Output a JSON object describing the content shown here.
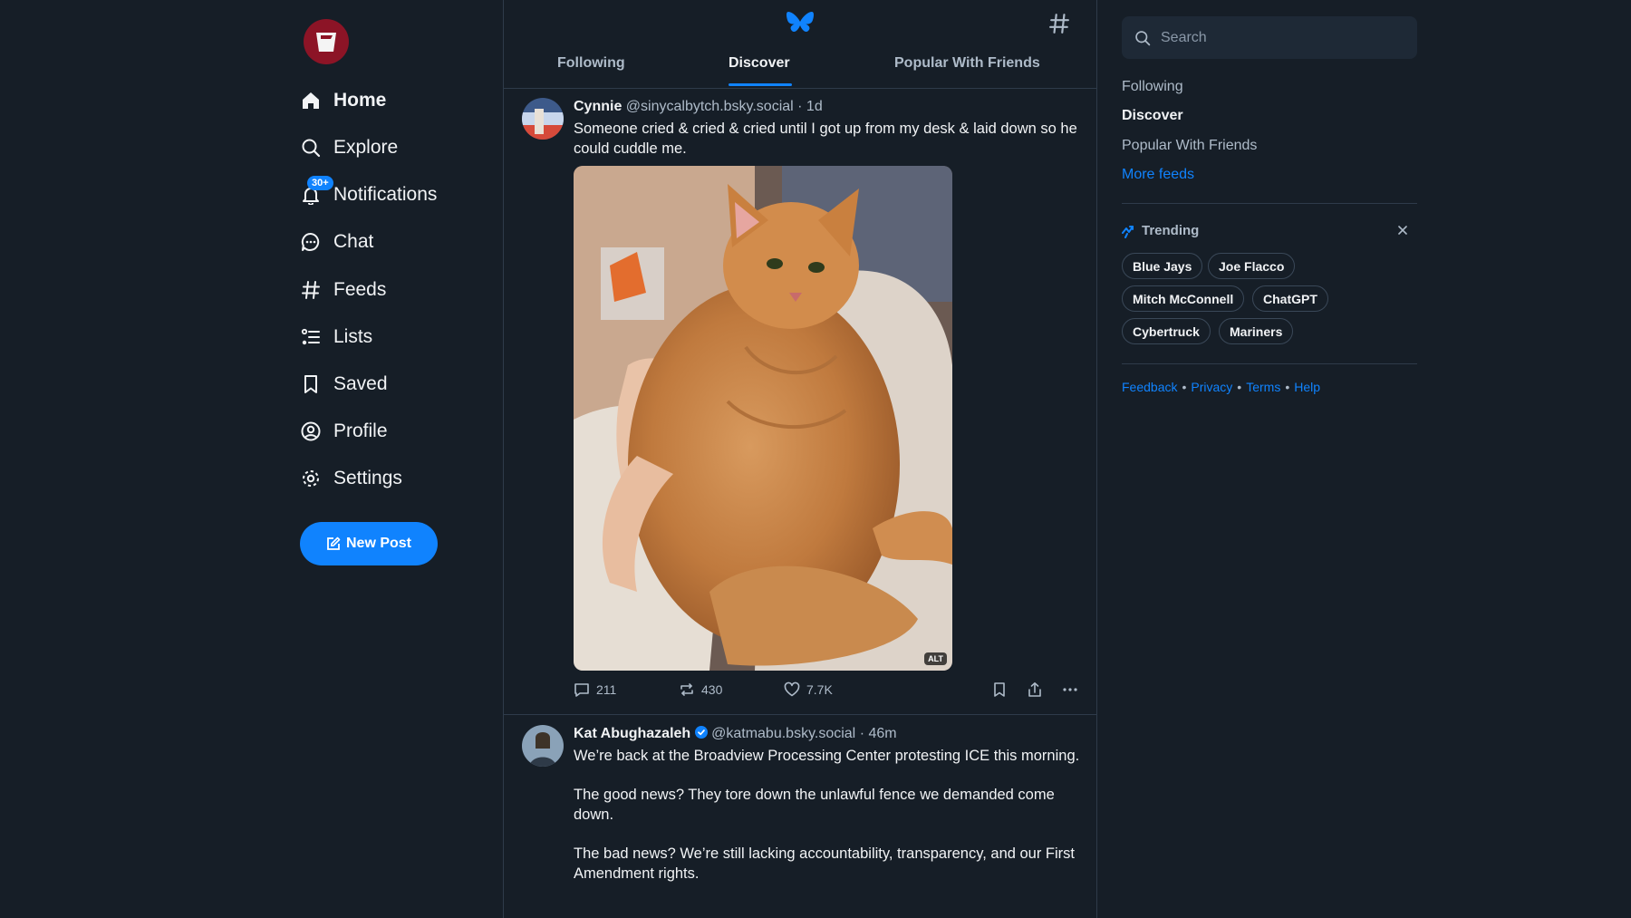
{
  "nav": {
    "items": [
      {
        "label": "Home",
        "icon": "home-icon"
      },
      {
        "label": "Explore",
        "icon": "search-icon"
      },
      {
        "label": "Notifications",
        "icon": "bell-icon"
      },
      {
        "label": "Chat",
        "icon": "chat-icon"
      },
      {
        "label": "Feeds",
        "icon": "hash-icon"
      },
      {
        "label": "Lists",
        "icon": "list-icon"
      },
      {
        "label": "Saved",
        "icon": "bookmark-icon"
      },
      {
        "label": "Profile",
        "icon": "profile-icon"
      },
      {
        "label": "Settings",
        "icon": "gear-icon"
      }
    ],
    "notification_badge": "30+",
    "new_post_label": "New Post"
  },
  "header": {
    "tabs": [
      {
        "label": "Following"
      },
      {
        "label": "Discover"
      },
      {
        "label": "Popular With Friends"
      }
    ],
    "active_tab": "Discover"
  },
  "posts": [
    {
      "name": "Cynnie",
      "handle": "@sinycalbytch.bsky.social",
      "time": "· 1d",
      "text": "Someone cried & cried & cried until I got up from my desk & laid down so he could cuddle me.",
      "image_alt_badge": "ALT",
      "replies": "211",
      "reposts": "430",
      "likes": "7.7K"
    },
    {
      "name": "Kat Abughazaleh",
      "handle": "@katmabu.bsky.social",
      "time": "· 46m",
      "paragraphs": [
        "We’re back at the Broadview Processing Center protesting ICE this morning.",
        "The good news? They tore down the unlawful fence we demanded come down.",
        "The bad news? We’re still lacking accountability, transparency, and our First Amendment rights."
      ]
    }
  ],
  "sidebar": {
    "search_placeholder": "Search",
    "feeds": [
      {
        "label": "Following"
      },
      {
        "label": "Discover"
      },
      {
        "label": "Popular With Friends"
      }
    ],
    "more_feeds": "More feeds",
    "trending_title": "Trending",
    "trending": [
      "Blue Jays",
      "Joe Flacco",
      "Mitch McConnell",
      "ChatGPT",
      "Cybertruck",
      "Mariners"
    ],
    "footer": [
      "Feedback",
      "Privacy",
      "Terms",
      "Help"
    ]
  },
  "colors": {
    "background": "#161e27",
    "accent": "#1083fe",
    "text": "#f1f3f5",
    "muted": "#aebbc9"
  }
}
